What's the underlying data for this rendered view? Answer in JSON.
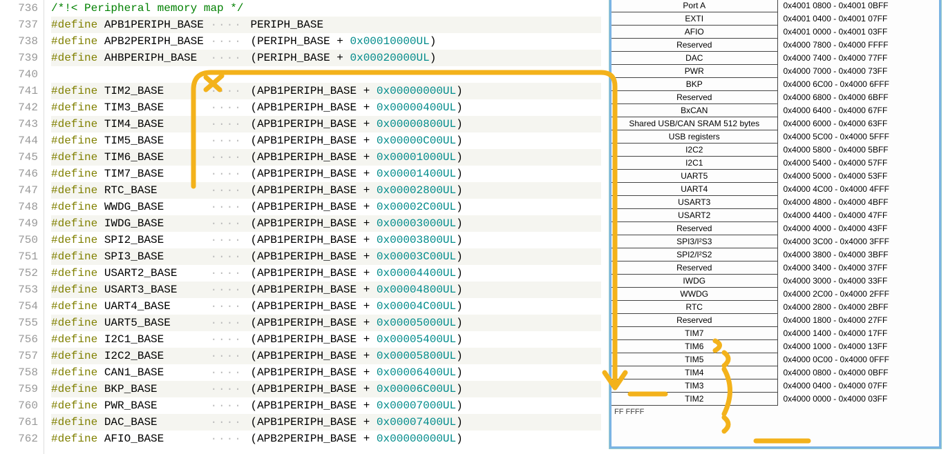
{
  "lines": [
    {
      "n": 736,
      "type": "comment",
      "text": "/*!< Peripheral memory map */"
    },
    {
      "n": 737,
      "type": "def",
      "name": "APB1PERIPH_BASE",
      "expr": "PERIPH_BASE",
      "hex": ""
    },
    {
      "n": 738,
      "type": "def",
      "name": "APB2PERIPH_BASE",
      "expr": "(PERIPH_BASE + ",
      "hex": "0x00010000UL",
      ")": ")"
    },
    {
      "n": 739,
      "type": "def",
      "name": "AHBPERIPH_BASE",
      "expr": "(PERIPH_BASE + ",
      "hex": "0x00020000UL",
      ")": ")"
    },
    {
      "n": 740,
      "type": "blank"
    },
    {
      "n": 741,
      "type": "def",
      "name": "TIM2_BASE",
      "expr": "(APB1PERIPH_BASE + ",
      "hex": "0x00000000UL",
      ")": ")"
    },
    {
      "n": 742,
      "type": "def",
      "name": "TIM3_BASE",
      "expr": "(APB1PERIPH_BASE + ",
      "hex": "0x00000400UL",
      ")": ")"
    },
    {
      "n": 743,
      "type": "def",
      "name": "TIM4_BASE",
      "expr": "(APB1PERIPH_BASE + ",
      "hex": "0x00000800UL",
      ")": ")"
    },
    {
      "n": 744,
      "type": "def",
      "name": "TIM5_BASE",
      "expr": "(APB1PERIPH_BASE + ",
      "hex": "0x00000C00UL",
      ")": ")"
    },
    {
      "n": 745,
      "type": "def",
      "name": "TIM6_BASE",
      "expr": "(APB1PERIPH_BASE + ",
      "hex": "0x00001000UL",
      ")": ")"
    },
    {
      "n": 746,
      "type": "def",
      "name": "TIM7_BASE",
      "expr": "(APB1PERIPH_BASE + ",
      "hex": "0x00001400UL",
      ")": ")"
    },
    {
      "n": 747,
      "type": "def",
      "name": "RTC_BASE",
      "expr": "(APB1PERIPH_BASE + ",
      "hex": "0x00002800UL",
      ")": ")"
    },
    {
      "n": 748,
      "type": "def",
      "name": "WWDG_BASE",
      "expr": "(APB1PERIPH_BASE + ",
      "hex": "0x00002C00UL",
      ")": ")"
    },
    {
      "n": 749,
      "type": "def",
      "name": "IWDG_BASE",
      "expr": "(APB1PERIPH_BASE + ",
      "hex": "0x00003000UL",
      ")": ")"
    },
    {
      "n": 750,
      "type": "def",
      "name": "SPI2_BASE",
      "expr": "(APB1PERIPH_BASE + ",
      "hex": "0x00003800UL",
      ")": ")"
    },
    {
      "n": 751,
      "type": "def",
      "name": "SPI3_BASE",
      "expr": "(APB1PERIPH_BASE + ",
      "hex": "0x00003C00UL",
      ")": ")"
    },
    {
      "n": 752,
      "type": "def",
      "name": "USART2_BASE",
      "expr": "(APB1PERIPH_BASE + ",
      "hex": "0x00004400UL",
      ")": ")"
    },
    {
      "n": 753,
      "type": "def",
      "name": "USART3_BASE",
      "expr": "(APB1PERIPH_BASE + ",
      "hex": "0x00004800UL",
      ")": ")"
    },
    {
      "n": 754,
      "type": "def",
      "name": "UART4_BASE",
      "expr": "(APB1PERIPH_BASE + ",
      "hex": "0x00004C00UL",
      ")": ")"
    },
    {
      "n": 755,
      "type": "def",
      "name": "UART5_BASE",
      "expr": "(APB1PERIPH_BASE + ",
      "hex": "0x00005000UL",
      ")": ")"
    },
    {
      "n": 756,
      "type": "def",
      "name": "I2C1_BASE",
      "expr": "(APB1PERIPH_BASE + ",
      "hex": "0x00005400UL",
      ")": ")"
    },
    {
      "n": 757,
      "type": "def",
      "name": "I2C2_BASE",
      "expr": "(APB1PERIPH_BASE + ",
      "hex": "0x00005800UL",
      ")": ")"
    },
    {
      "n": 758,
      "type": "def",
      "name": "CAN1_BASE",
      "expr": "(APB1PERIPH_BASE + ",
      "hex": "0x00006400UL",
      ")": ")"
    },
    {
      "n": 759,
      "type": "def",
      "name": "BKP_BASE",
      "expr": "(APB1PERIPH_BASE + ",
      "hex": "0x00006C00UL",
      ")": ")"
    },
    {
      "n": 760,
      "type": "def",
      "name": "PWR_BASE",
      "expr": "(APB1PERIPH_BASE + ",
      "hex": "0x00007000UL",
      ")": ")"
    },
    {
      "n": 761,
      "type": "def",
      "name": "DAC_BASE",
      "expr": "(APB1PERIPH_BASE + ",
      "hex": "0x00007400UL",
      ")": ")"
    },
    {
      "n": 762,
      "type": "def",
      "name": "AFIO_BASE",
      "expr": "(APB2PERIPH_BASE + ",
      "hex": "0x00000000UL",
      ")": ")"
    }
  ],
  "memmap": [
    {
      "name": "Port A",
      "addr": "0x4001 0800 - 0x4001 0BFF"
    },
    {
      "name": "EXTI",
      "addr": "0x4001 0400 - 0x4001 07FF"
    },
    {
      "name": "AFIO",
      "addr": "0x4001 0000 - 0x4001 03FF"
    },
    {
      "name": "Reserved",
      "addr": "0x4000 7800 - 0x4000 FFFF"
    },
    {
      "name": "DAC",
      "addr": "0x4000 7400 - 0x4000 77FF"
    },
    {
      "name": "PWR",
      "addr": "0x4000 7000 - 0x4000 73FF"
    },
    {
      "name": "BKP",
      "addr": "0x4000 6C00 - 0x4000 6FFF"
    },
    {
      "name": "Reserved",
      "addr": "0x4000 6800 - 0x4000 6BFF"
    },
    {
      "name": "BxCAN",
      "addr": "0x4000 6400 - 0x4000 67FF"
    },
    {
      "name": "Shared USB/CAN SRAM 512 bytes",
      "addr": "0x4000 6000 - 0x4000 63FF"
    },
    {
      "name": "USB registers",
      "addr": "0x4000 5C00 - 0x4000 5FFF"
    },
    {
      "name": "I2C2",
      "addr": "0x4000 5800 - 0x4000 5BFF"
    },
    {
      "name": "I2C1",
      "addr": "0x4000 5400 - 0x4000 57FF"
    },
    {
      "name": "UART5",
      "addr": "0x4000 5000 - 0x4000 53FF"
    },
    {
      "name": "UART4",
      "addr": "0x4000 4C00 - 0x4000 4FFF"
    },
    {
      "name": "USART3",
      "addr": "0x4000 4800 - 0x4000 4BFF"
    },
    {
      "name": "USART2",
      "addr": "0x4000 4400 - 0x4000 47FF"
    },
    {
      "name": "Reserved",
      "addr": "0x4000 4000 - 0x4000 43FF"
    },
    {
      "name": "SPI3/I²S3",
      "addr": "0x4000 3C00 - 0x4000 3FFF"
    },
    {
      "name": "SPI2/I²S2",
      "addr": "0x4000 3800 - 0x4000 3BFF"
    },
    {
      "name": "Reserved",
      "addr": "0x4000 3400 - 0x4000 37FF"
    },
    {
      "name": "IWDG",
      "addr": "0x4000 3000 - 0x4000 33FF"
    },
    {
      "name": "WWDG",
      "addr": "0x4000 2C00 - 0x4000 2FFF"
    },
    {
      "name": "RTC",
      "addr": "0x4000 2800 - 0x4000 2BFF"
    },
    {
      "name": "Reserved",
      "addr": "0x4000 1800 - 0x4000 27FF"
    },
    {
      "name": "TIM7",
      "addr": "0x4000 1400 - 0x4000 17FF"
    },
    {
      "name": "TIM6",
      "addr": "0x4000 1000 - 0x4000 13FF"
    },
    {
      "name": "TIM5",
      "addr": "0x4000 0C00 - 0x4000 0FFF"
    },
    {
      "name": "TIM4",
      "addr": "0x4000 0800 - 0x4000 0BFF"
    },
    {
      "name": "TIM3",
      "addr": "0x4000 0400 - 0x4000 07FF"
    },
    {
      "name": "TIM2",
      "addr": "0x4000 0000 - 0x4000 03FF"
    }
  ],
  "footer": "FF FFFF"
}
